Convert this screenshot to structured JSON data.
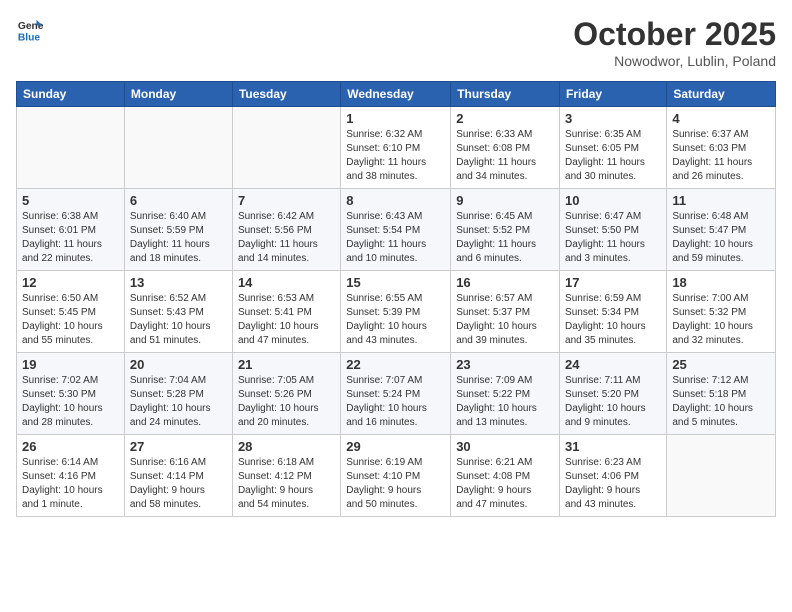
{
  "logo": {
    "line1": "General",
    "line2": "Blue"
  },
  "title": "October 2025",
  "location": "Nowodwor, Lublin, Poland",
  "weekdays": [
    "Sunday",
    "Monday",
    "Tuesday",
    "Wednesday",
    "Thursday",
    "Friday",
    "Saturday"
  ],
  "weeks": [
    [
      {
        "day": "",
        "info": ""
      },
      {
        "day": "",
        "info": ""
      },
      {
        "day": "",
        "info": ""
      },
      {
        "day": "1",
        "info": "Sunrise: 6:32 AM\nSunset: 6:10 PM\nDaylight: 11 hours\nand 38 minutes."
      },
      {
        "day": "2",
        "info": "Sunrise: 6:33 AM\nSunset: 6:08 PM\nDaylight: 11 hours\nand 34 minutes."
      },
      {
        "day": "3",
        "info": "Sunrise: 6:35 AM\nSunset: 6:05 PM\nDaylight: 11 hours\nand 30 minutes."
      },
      {
        "day": "4",
        "info": "Sunrise: 6:37 AM\nSunset: 6:03 PM\nDaylight: 11 hours\nand 26 minutes."
      }
    ],
    [
      {
        "day": "5",
        "info": "Sunrise: 6:38 AM\nSunset: 6:01 PM\nDaylight: 11 hours\nand 22 minutes."
      },
      {
        "day": "6",
        "info": "Sunrise: 6:40 AM\nSunset: 5:59 PM\nDaylight: 11 hours\nand 18 minutes."
      },
      {
        "day": "7",
        "info": "Sunrise: 6:42 AM\nSunset: 5:56 PM\nDaylight: 11 hours\nand 14 minutes."
      },
      {
        "day": "8",
        "info": "Sunrise: 6:43 AM\nSunset: 5:54 PM\nDaylight: 11 hours\nand 10 minutes."
      },
      {
        "day": "9",
        "info": "Sunrise: 6:45 AM\nSunset: 5:52 PM\nDaylight: 11 hours\nand 6 minutes."
      },
      {
        "day": "10",
        "info": "Sunrise: 6:47 AM\nSunset: 5:50 PM\nDaylight: 11 hours\nand 3 minutes."
      },
      {
        "day": "11",
        "info": "Sunrise: 6:48 AM\nSunset: 5:47 PM\nDaylight: 10 hours\nand 59 minutes."
      }
    ],
    [
      {
        "day": "12",
        "info": "Sunrise: 6:50 AM\nSunset: 5:45 PM\nDaylight: 10 hours\nand 55 minutes."
      },
      {
        "day": "13",
        "info": "Sunrise: 6:52 AM\nSunset: 5:43 PM\nDaylight: 10 hours\nand 51 minutes."
      },
      {
        "day": "14",
        "info": "Sunrise: 6:53 AM\nSunset: 5:41 PM\nDaylight: 10 hours\nand 47 minutes."
      },
      {
        "day": "15",
        "info": "Sunrise: 6:55 AM\nSunset: 5:39 PM\nDaylight: 10 hours\nand 43 minutes."
      },
      {
        "day": "16",
        "info": "Sunrise: 6:57 AM\nSunset: 5:37 PM\nDaylight: 10 hours\nand 39 minutes."
      },
      {
        "day": "17",
        "info": "Sunrise: 6:59 AM\nSunset: 5:34 PM\nDaylight: 10 hours\nand 35 minutes."
      },
      {
        "day": "18",
        "info": "Sunrise: 7:00 AM\nSunset: 5:32 PM\nDaylight: 10 hours\nand 32 minutes."
      }
    ],
    [
      {
        "day": "19",
        "info": "Sunrise: 7:02 AM\nSunset: 5:30 PM\nDaylight: 10 hours\nand 28 minutes."
      },
      {
        "day": "20",
        "info": "Sunrise: 7:04 AM\nSunset: 5:28 PM\nDaylight: 10 hours\nand 24 minutes."
      },
      {
        "day": "21",
        "info": "Sunrise: 7:05 AM\nSunset: 5:26 PM\nDaylight: 10 hours\nand 20 minutes."
      },
      {
        "day": "22",
        "info": "Sunrise: 7:07 AM\nSunset: 5:24 PM\nDaylight: 10 hours\nand 16 minutes."
      },
      {
        "day": "23",
        "info": "Sunrise: 7:09 AM\nSunset: 5:22 PM\nDaylight: 10 hours\nand 13 minutes."
      },
      {
        "day": "24",
        "info": "Sunrise: 7:11 AM\nSunset: 5:20 PM\nDaylight: 10 hours\nand 9 minutes."
      },
      {
        "day": "25",
        "info": "Sunrise: 7:12 AM\nSunset: 5:18 PM\nDaylight: 10 hours\nand 5 minutes."
      }
    ],
    [
      {
        "day": "26",
        "info": "Sunrise: 6:14 AM\nSunset: 4:16 PM\nDaylight: 10 hours\nand 1 minute."
      },
      {
        "day": "27",
        "info": "Sunrise: 6:16 AM\nSunset: 4:14 PM\nDaylight: 9 hours\nand 58 minutes."
      },
      {
        "day": "28",
        "info": "Sunrise: 6:18 AM\nSunset: 4:12 PM\nDaylight: 9 hours\nand 54 minutes."
      },
      {
        "day": "29",
        "info": "Sunrise: 6:19 AM\nSunset: 4:10 PM\nDaylight: 9 hours\nand 50 minutes."
      },
      {
        "day": "30",
        "info": "Sunrise: 6:21 AM\nSunset: 4:08 PM\nDaylight: 9 hours\nand 47 minutes."
      },
      {
        "day": "31",
        "info": "Sunrise: 6:23 AM\nSunset: 4:06 PM\nDaylight: 9 hours\nand 43 minutes."
      },
      {
        "day": "",
        "info": ""
      }
    ]
  ]
}
